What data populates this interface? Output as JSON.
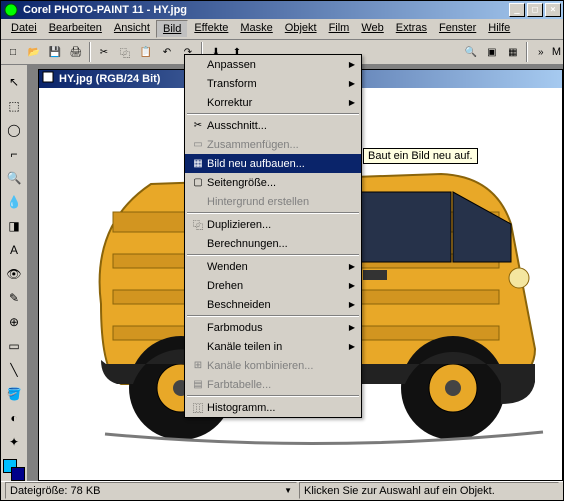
{
  "title": "Corel PHOTO-PAINT 11 - HY.jpg",
  "menubar": [
    "Datei",
    "Bearbeiten",
    "Ansicht",
    "Bild",
    "Effekte",
    "Maske",
    "Objekt",
    "Film",
    "Web",
    "Extras",
    "Fenster",
    "Hilfe"
  ],
  "childTitle": "HY.jpg (RGB/24 Bit)",
  "dropdown": {
    "items": [
      {
        "label": "Anpassen",
        "arrow": true
      },
      {
        "label": "Transform",
        "arrow": true
      },
      {
        "label": "Korrektur",
        "arrow": true
      },
      {
        "sep": true
      },
      {
        "label": "Ausschnitt...",
        "icon": "✂"
      },
      {
        "label": "Zusammenfügen...",
        "disabled": true,
        "icon": "▭"
      },
      {
        "label": "Bild neu aufbauen...",
        "icon": "▦",
        "hl": true
      },
      {
        "label": "Seitengröße...",
        "icon": "▢"
      },
      {
        "label": "Hintergrund erstellen",
        "disabled": true
      },
      {
        "sep": true
      },
      {
        "label": "Duplizieren...",
        "icon": "⿻"
      },
      {
        "label": "Berechnungen..."
      },
      {
        "sep": true
      },
      {
        "label": "Wenden",
        "arrow": true
      },
      {
        "label": "Drehen",
        "arrow": true
      },
      {
        "label": "Beschneiden",
        "arrow": true
      },
      {
        "sep": true
      },
      {
        "label": "Farbmodus",
        "arrow": true
      },
      {
        "label": "Kanäle teilen in",
        "arrow": true
      },
      {
        "label": "Kanäle kombinieren...",
        "disabled": true,
        "icon": "⊞"
      },
      {
        "label": "Farbtabelle...",
        "disabled": true,
        "icon": "▤"
      },
      {
        "sep": true
      },
      {
        "label": "Histogramm...",
        "icon": "⿲"
      }
    ]
  },
  "tooltip": "Baut ein Bild neu auf.",
  "status": {
    "left": "Dateigröße: 78 KB",
    "right": "Klicken Sie zur Auswahl auf ein Objekt."
  }
}
